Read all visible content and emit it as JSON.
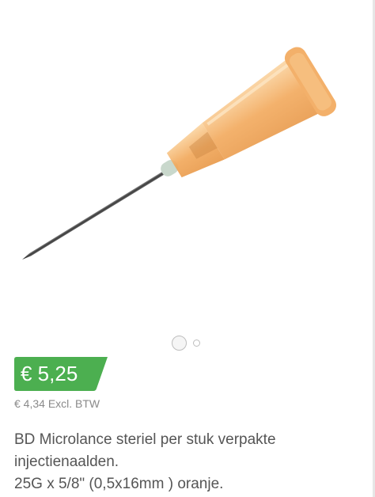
{
  "product": {
    "image_icon": "injection-needle-orange",
    "carousel": {
      "count": 2,
      "active_index": 0
    },
    "price": "€ 5,25",
    "price_excl": "€ 4,34 Excl. BTW",
    "description_lines": [
      "BD Microlance steriel per stuk verpakte",
      "injectienaalden.",
      "25G x 5/8\" (0,5x16mm ) oranje."
    ]
  },
  "colors": {
    "price_badge": "#4caf50",
    "hub_orange": "#f5b56c",
    "text": "#555555"
  }
}
